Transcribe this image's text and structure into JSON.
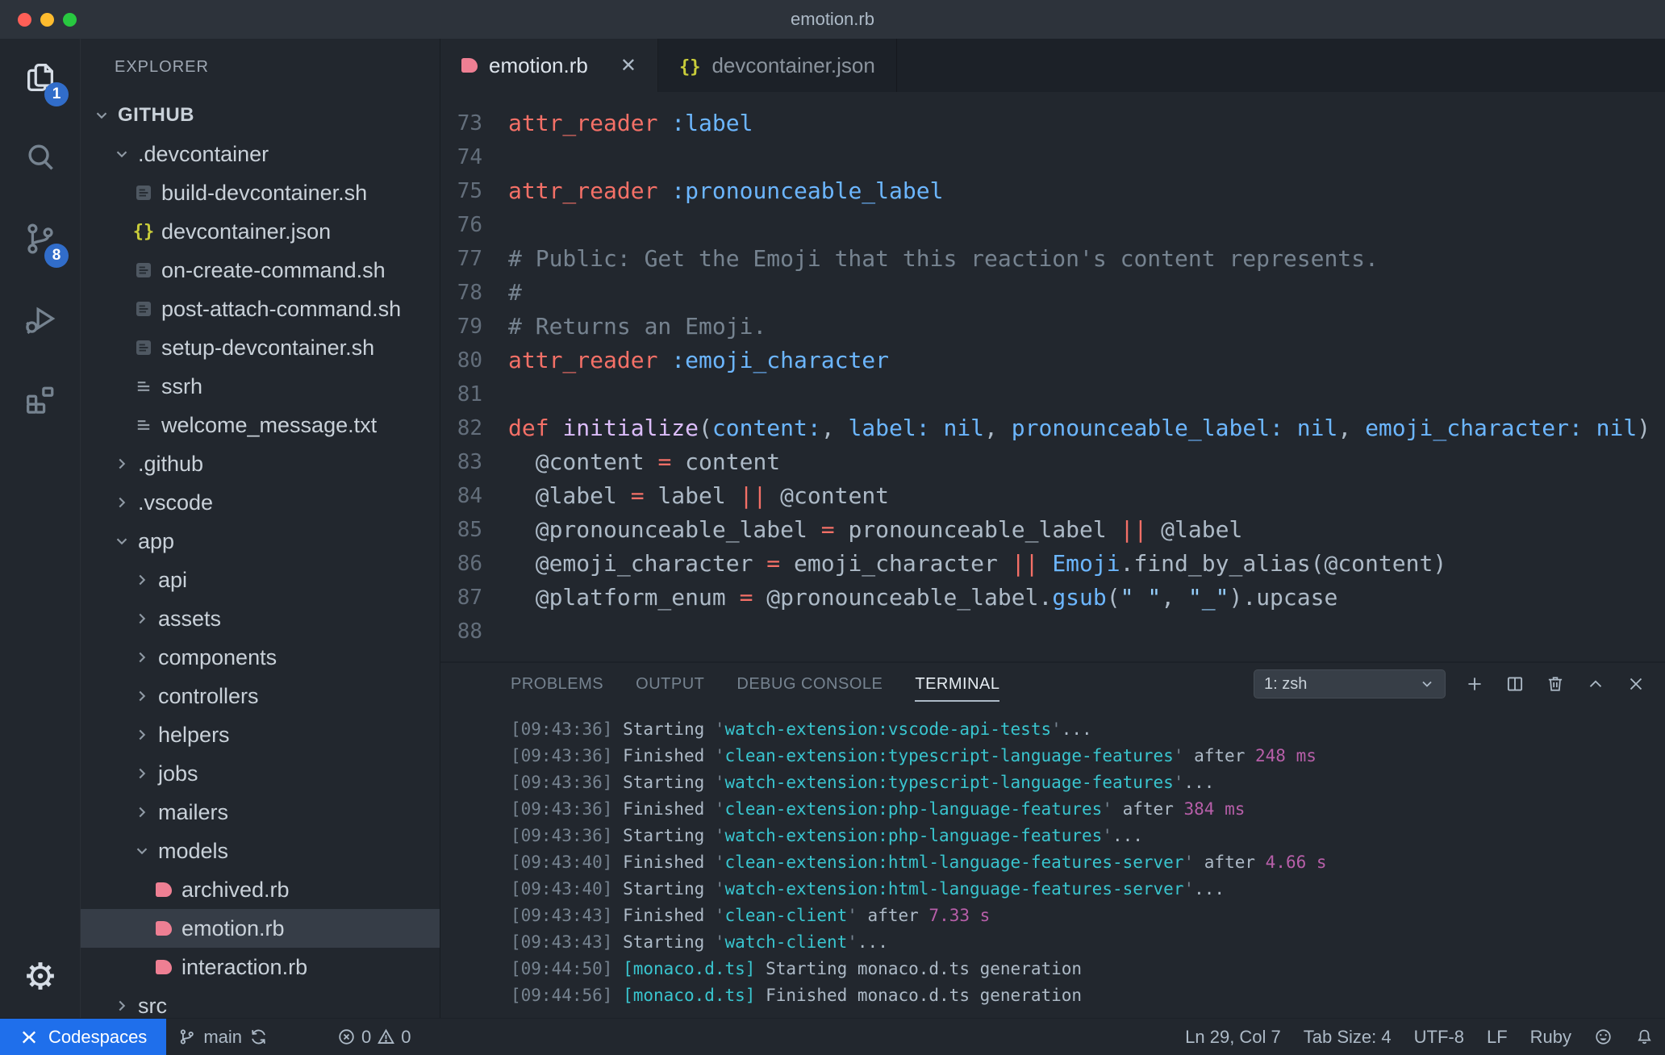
{
  "window": {
    "title": "emotion.rb"
  },
  "colors": {
    "accent_blue": "#1f6feb",
    "badge_blue": "#316dca",
    "ruby_pink": "#ee7f93",
    "json_yellow": "#c9cd3a",
    "keyword_red": "#f47067",
    "symbol_blue": "#6cb6ff",
    "function_purple": "#dcbdfb",
    "string_blue": "#96d0ff",
    "comment_gray": "#768390",
    "terminal_cyan": "#39c5cf",
    "terminal_magenta": "#b75fa9"
  },
  "activity_bar": {
    "items": [
      {
        "name": "explorer",
        "icon": "files",
        "badge": "1",
        "active": true
      },
      {
        "name": "search",
        "icon": "search",
        "badge": "",
        "active": false
      },
      {
        "name": "source-control",
        "icon": "branch-big",
        "badge": "8",
        "active": false
      },
      {
        "name": "run-debug",
        "icon": "debug",
        "badge": "",
        "active": false
      },
      {
        "name": "extensions",
        "icon": "extensions",
        "badge": "",
        "active": false
      }
    ],
    "bottom": [
      {
        "name": "settings",
        "icon": "gear",
        "active": true
      }
    ]
  },
  "sidebar": {
    "header": "EXPLORER",
    "tree": [
      {
        "label": "GITHUB",
        "indent": 0,
        "icon": "chevron-down",
        "root": true,
        "selected": false
      },
      {
        "label": ".devcontainer",
        "indent": 1,
        "icon": "chevron-down",
        "selected": false
      },
      {
        "label": "build-devcontainer.sh",
        "indent": 2,
        "icon": "doc",
        "selected": false
      },
      {
        "label": "devcontainer.json",
        "indent": 2,
        "icon": "json",
        "selected": false
      },
      {
        "label": "on-create-command.sh",
        "indent": 2,
        "icon": "doc",
        "selected": false
      },
      {
        "label": "post-attach-command.sh",
        "indent": 2,
        "icon": "doc",
        "selected": false
      },
      {
        "label": "setup-devcontainer.sh",
        "indent": 2,
        "icon": "doc",
        "selected": false
      },
      {
        "label": "ssrh",
        "indent": 2,
        "icon": "lines",
        "selected": false
      },
      {
        "label": "welcome_message.txt",
        "indent": 2,
        "icon": "lines",
        "selected": false
      },
      {
        "label": ".github",
        "indent": 1,
        "icon": "chevron-right",
        "selected": false
      },
      {
        "label": ".vscode",
        "indent": 1,
        "icon": "chevron-right",
        "selected": false
      },
      {
        "label": "app",
        "indent": 1,
        "icon": "chevron-down",
        "selected": false
      },
      {
        "label": "api",
        "indent": 2,
        "icon": "chevron-right",
        "selected": false
      },
      {
        "label": "assets",
        "indent": 2,
        "icon": "chevron-right",
        "selected": false
      },
      {
        "label": "components",
        "indent": 2,
        "icon": "chevron-right",
        "selected": false
      },
      {
        "label": "controllers",
        "indent": 2,
        "icon": "chevron-right",
        "selected": false
      },
      {
        "label": "helpers",
        "indent": 2,
        "icon": "chevron-right",
        "selected": false
      },
      {
        "label": "jobs",
        "indent": 2,
        "icon": "chevron-right",
        "selected": false
      },
      {
        "label": "mailers",
        "indent": 2,
        "icon": "chevron-right",
        "selected": false
      },
      {
        "label": "models",
        "indent": 2,
        "icon": "chevron-down",
        "selected": false
      },
      {
        "label": "archived.rb",
        "indent": 3,
        "icon": "ruby",
        "selected": false
      },
      {
        "label": "emotion.rb",
        "indent": 3,
        "icon": "ruby",
        "selected": true
      },
      {
        "label": "interaction.rb",
        "indent": 3,
        "icon": "ruby",
        "selected": false
      },
      {
        "label": "src",
        "indent": 1,
        "icon": "chevron-right",
        "selected": false
      }
    ]
  },
  "editor": {
    "tabs": [
      {
        "label": "emotion.rb",
        "icon": "ruby",
        "active": true,
        "closable": true
      },
      {
        "label": "devcontainer.json",
        "icon": "json",
        "active": false,
        "closable": false
      }
    ],
    "lines": [
      {
        "num": "73",
        "tokens": [
          [
            "k",
            "attr_reader"
          ],
          [
            "p",
            " "
          ],
          [
            "b",
            ":label"
          ]
        ]
      },
      {
        "num": "74",
        "tokens": []
      },
      {
        "num": "75",
        "tokens": [
          [
            "k",
            "attr_reader"
          ],
          [
            "p",
            " "
          ],
          [
            "b",
            ":pronounceable_label"
          ]
        ]
      },
      {
        "num": "76",
        "tokens": []
      },
      {
        "num": "77",
        "tokens": [
          [
            "c",
            "# Public: Get the Emoji that this reaction's content represents."
          ]
        ]
      },
      {
        "num": "78",
        "tokens": [
          [
            "c",
            "#"
          ]
        ]
      },
      {
        "num": "79",
        "tokens": [
          [
            "c",
            "# Returns an Emoji."
          ]
        ]
      },
      {
        "num": "80",
        "tokens": [
          [
            "k",
            "attr_reader"
          ],
          [
            "p",
            " "
          ],
          [
            "b",
            ":emoji_character"
          ]
        ]
      },
      {
        "num": "81",
        "tokens": []
      },
      {
        "num": "82",
        "tokens": [
          [
            "k",
            "def"
          ],
          [
            "p",
            " "
          ],
          [
            "f",
            "initialize"
          ],
          [
            "p",
            "("
          ],
          [
            "b",
            "content:"
          ],
          [
            "p",
            ", "
          ],
          [
            "b",
            "label:"
          ],
          [
            "p",
            " "
          ],
          [
            "b",
            "nil"
          ],
          [
            "p",
            ", "
          ],
          [
            "b",
            "pronounceable_label:"
          ],
          [
            "p",
            " "
          ],
          [
            "b",
            "nil"
          ],
          [
            "p",
            ", "
          ],
          [
            "b",
            "emoji_character:"
          ],
          [
            "p",
            " "
          ],
          [
            "b",
            "nil"
          ],
          [
            "p",
            ")"
          ]
        ]
      },
      {
        "num": "83",
        "tokens": [
          [
            "p",
            "  @content "
          ],
          [
            "k",
            "="
          ],
          [
            "p",
            " content"
          ]
        ]
      },
      {
        "num": "84",
        "tokens": [
          [
            "p",
            "  @label "
          ],
          [
            "k",
            "="
          ],
          [
            "p",
            " label "
          ],
          [
            "k",
            "||"
          ],
          [
            "p",
            " @content"
          ]
        ]
      },
      {
        "num": "85",
        "tokens": [
          [
            "p",
            "  @pronounceable_label "
          ],
          [
            "k",
            "="
          ],
          [
            "p",
            " pronounceable_label "
          ],
          [
            "k",
            "||"
          ],
          [
            "p",
            " @label"
          ]
        ]
      },
      {
        "num": "86",
        "tokens": [
          [
            "p",
            "  @emoji_character "
          ],
          [
            "k",
            "="
          ],
          [
            "p",
            " emoji_character "
          ],
          [
            "k",
            "||"
          ],
          [
            "p",
            " "
          ],
          [
            "b",
            "Emoji"
          ],
          [
            "p",
            ".find_by_alias(@content)"
          ]
        ]
      },
      {
        "num": "87",
        "tokens": [
          [
            "p",
            "  @platform_enum "
          ],
          [
            "k",
            "="
          ],
          [
            "p",
            " @pronounceable_label."
          ],
          [
            "b",
            "gsub"
          ],
          [
            "p",
            "("
          ],
          [
            "s",
            "\" \""
          ],
          [
            "p",
            ", "
          ],
          [
            "s",
            "\"_\""
          ],
          [
            "p",
            ").upcase"
          ]
        ]
      },
      {
        "num": "88",
        "tokens": []
      }
    ]
  },
  "panel": {
    "tabs": [
      {
        "label": "PROBLEMS",
        "active": false
      },
      {
        "label": "OUTPUT",
        "active": false
      },
      {
        "label": "DEBUG CONSOLE",
        "active": false
      },
      {
        "label": "TERMINAL",
        "active": true
      }
    ],
    "dropdown_value": "1: zsh",
    "actions": [
      {
        "name": "new-terminal",
        "icon": "plus"
      },
      {
        "name": "split-terminal",
        "icon": "split"
      },
      {
        "name": "kill-terminal",
        "icon": "trash"
      },
      {
        "name": "maximize-panel",
        "icon": "chevron-up"
      },
      {
        "name": "close-panel",
        "icon": "close"
      }
    ],
    "terminal_lines": [
      [
        [
          "t",
          "[09:43:36]"
        ],
        [
          "w",
          " Starting "
        ],
        [
          "q",
          "'"
        ],
        [
          "cy",
          "watch-extension:vscode-api-tests"
        ],
        [
          "q",
          "'"
        ],
        [
          "w",
          "..."
        ]
      ],
      [
        [
          "t",
          "[09:43:36]"
        ],
        [
          "w",
          " Finished "
        ],
        [
          "q",
          "'"
        ],
        [
          "cy",
          "clean-extension:typescript-language-features"
        ],
        [
          "q",
          "'"
        ],
        [
          "w",
          " after "
        ],
        [
          "m",
          "248 ms"
        ]
      ],
      [
        [
          "t",
          "[09:43:36]"
        ],
        [
          "w",
          " Starting "
        ],
        [
          "q",
          "'"
        ],
        [
          "cy",
          "watch-extension:typescript-language-features"
        ],
        [
          "q",
          "'"
        ],
        [
          "w",
          "..."
        ]
      ],
      [
        [
          "t",
          "[09:43:36]"
        ],
        [
          "w",
          " Finished "
        ],
        [
          "q",
          "'"
        ],
        [
          "cy",
          "clean-extension:php-language-features"
        ],
        [
          "q",
          "'"
        ],
        [
          "w",
          " after "
        ],
        [
          "m",
          "384 ms"
        ]
      ],
      [
        [
          "t",
          "[09:43:36]"
        ],
        [
          "w",
          " Starting "
        ],
        [
          "q",
          "'"
        ],
        [
          "cy",
          "watch-extension:php-language-features"
        ],
        [
          "q",
          "'"
        ],
        [
          "w",
          "..."
        ]
      ],
      [
        [
          "t",
          "[09:43:40]"
        ],
        [
          "w",
          " Finished "
        ],
        [
          "q",
          "'"
        ],
        [
          "cy",
          "clean-extension:html-language-features-server"
        ],
        [
          "q",
          "'"
        ],
        [
          "w",
          " after "
        ],
        [
          "m",
          "4.66 s"
        ]
      ],
      [
        [
          "t",
          "[09:43:40]"
        ],
        [
          "w",
          " Starting "
        ],
        [
          "q",
          "'"
        ],
        [
          "cy",
          "watch-extension:html-language-features-server"
        ],
        [
          "q",
          "'"
        ],
        [
          "w",
          "..."
        ]
      ],
      [
        [
          "t",
          "[09:43:43]"
        ],
        [
          "w",
          " Finished "
        ],
        [
          "q",
          "'"
        ],
        [
          "cy",
          "clean-client"
        ],
        [
          "q",
          "'"
        ],
        [
          "w",
          " after "
        ],
        [
          "m",
          "7.33 s"
        ]
      ],
      [
        [
          "t",
          "[09:43:43]"
        ],
        [
          "w",
          " Starting "
        ],
        [
          "q",
          "'"
        ],
        [
          "cy",
          "watch-client"
        ],
        [
          "q",
          "'"
        ],
        [
          "w",
          "..."
        ]
      ],
      [
        [
          "t",
          "[09:44:50]"
        ],
        [
          "w",
          " "
        ],
        [
          "cy",
          "[monaco.d.ts]"
        ],
        [
          "w",
          " Starting monaco.d.ts generation"
        ]
      ],
      [
        [
          "t",
          "[09:44:56]"
        ],
        [
          "w",
          " "
        ],
        [
          "cy",
          "[monaco.d.ts]"
        ],
        [
          "w",
          " Finished monaco.d.ts generation"
        ]
      ]
    ]
  },
  "status_bar": {
    "codespaces_label": "Codespaces",
    "branch": "main",
    "errors": "0",
    "warnings": "0",
    "right": [
      {
        "name": "cursor-position",
        "label": "Ln 29, Col 7"
      },
      {
        "name": "tab-size",
        "label": "Tab Size: 4"
      },
      {
        "name": "encoding",
        "label": "UTF-8"
      },
      {
        "name": "eol",
        "label": "LF"
      },
      {
        "name": "language-mode",
        "label": "Ruby"
      },
      {
        "name": "feedback",
        "icon": "smiley"
      },
      {
        "name": "notifications",
        "icon": "bell"
      }
    ]
  }
}
